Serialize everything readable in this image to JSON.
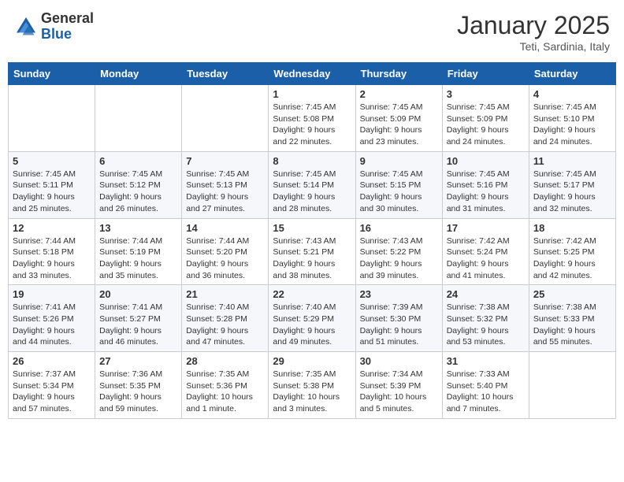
{
  "header": {
    "logo_general": "General",
    "logo_blue": "Blue",
    "month_title": "January 2025",
    "location": "Teti, Sardinia, Italy"
  },
  "days_of_week": [
    "Sunday",
    "Monday",
    "Tuesday",
    "Wednesday",
    "Thursday",
    "Friday",
    "Saturday"
  ],
  "weeks": [
    [
      {
        "day": "",
        "info": ""
      },
      {
        "day": "",
        "info": ""
      },
      {
        "day": "",
        "info": ""
      },
      {
        "day": "1",
        "info": "Sunrise: 7:45 AM\nSunset: 5:08 PM\nDaylight: 9 hours and 22 minutes."
      },
      {
        "day": "2",
        "info": "Sunrise: 7:45 AM\nSunset: 5:09 PM\nDaylight: 9 hours and 23 minutes."
      },
      {
        "day": "3",
        "info": "Sunrise: 7:45 AM\nSunset: 5:09 PM\nDaylight: 9 hours and 24 minutes."
      },
      {
        "day": "4",
        "info": "Sunrise: 7:45 AM\nSunset: 5:10 PM\nDaylight: 9 hours and 24 minutes."
      }
    ],
    [
      {
        "day": "5",
        "info": "Sunrise: 7:45 AM\nSunset: 5:11 PM\nDaylight: 9 hours and 25 minutes."
      },
      {
        "day": "6",
        "info": "Sunrise: 7:45 AM\nSunset: 5:12 PM\nDaylight: 9 hours and 26 minutes."
      },
      {
        "day": "7",
        "info": "Sunrise: 7:45 AM\nSunset: 5:13 PM\nDaylight: 9 hours and 27 minutes."
      },
      {
        "day": "8",
        "info": "Sunrise: 7:45 AM\nSunset: 5:14 PM\nDaylight: 9 hours and 28 minutes."
      },
      {
        "day": "9",
        "info": "Sunrise: 7:45 AM\nSunset: 5:15 PM\nDaylight: 9 hours and 30 minutes."
      },
      {
        "day": "10",
        "info": "Sunrise: 7:45 AM\nSunset: 5:16 PM\nDaylight: 9 hours and 31 minutes."
      },
      {
        "day": "11",
        "info": "Sunrise: 7:45 AM\nSunset: 5:17 PM\nDaylight: 9 hours and 32 minutes."
      }
    ],
    [
      {
        "day": "12",
        "info": "Sunrise: 7:44 AM\nSunset: 5:18 PM\nDaylight: 9 hours and 33 minutes."
      },
      {
        "day": "13",
        "info": "Sunrise: 7:44 AM\nSunset: 5:19 PM\nDaylight: 9 hours and 35 minutes."
      },
      {
        "day": "14",
        "info": "Sunrise: 7:44 AM\nSunset: 5:20 PM\nDaylight: 9 hours and 36 minutes."
      },
      {
        "day": "15",
        "info": "Sunrise: 7:43 AM\nSunset: 5:21 PM\nDaylight: 9 hours and 38 minutes."
      },
      {
        "day": "16",
        "info": "Sunrise: 7:43 AM\nSunset: 5:22 PM\nDaylight: 9 hours and 39 minutes."
      },
      {
        "day": "17",
        "info": "Sunrise: 7:42 AM\nSunset: 5:24 PM\nDaylight: 9 hours and 41 minutes."
      },
      {
        "day": "18",
        "info": "Sunrise: 7:42 AM\nSunset: 5:25 PM\nDaylight: 9 hours and 42 minutes."
      }
    ],
    [
      {
        "day": "19",
        "info": "Sunrise: 7:41 AM\nSunset: 5:26 PM\nDaylight: 9 hours and 44 minutes."
      },
      {
        "day": "20",
        "info": "Sunrise: 7:41 AM\nSunset: 5:27 PM\nDaylight: 9 hours and 46 minutes."
      },
      {
        "day": "21",
        "info": "Sunrise: 7:40 AM\nSunset: 5:28 PM\nDaylight: 9 hours and 47 minutes."
      },
      {
        "day": "22",
        "info": "Sunrise: 7:40 AM\nSunset: 5:29 PM\nDaylight: 9 hours and 49 minutes."
      },
      {
        "day": "23",
        "info": "Sunrise: 7:39 AM\nSunset: 5:30 PM\nDaylight: 9 hours and 51 minutes."
      },
      {
        "day": "24",
        "info": "Sunrise: 7:38 AM\nSunset: 5:32 PM\nDaylight: 9 hours and 53 minutes."
      },
      {
        "day": "25",
        "info": "Sunrise: 7:38 AM\nSunset: 5:33 PM\nDaylight: 9 hours and 55 minutes."
      }
    ],
    [
      {
        "day": "26",
        "info": "Sunrise: 7:37 AM\nSunset: 5:34 PM\nDaylight: 9 hours and 57 minutes."
      },
      {
        "day": "27",
        "info": "Sunrise: 7:36 AM\nSunset: 5:35 PM\nDaylight: 9 hours and 59 minutes."
      },
      {
        "day": "28",
        "info": "Sunrise: 7:35 AM\nSunset: 5:36 PM\nDaylight: 10 hours and 1 minute."
      },
      {
        "day": "29",
        "info": "Sunrise: 7:35 AM\nSunset: 5:38 PM\nDaylight: 10 hours and 3 minutes."
      },
      {
        "day": "30",
        "info": "Sunrise: 7:34 AM\nSunset: 5:39 PM\nDaylight: 10 hours and 5 minutes."
      },
      {
        "day": "31",
        "info": "Sunrise: 7:33 AM\nSunset: 5:40 PM\nDaylight: 10 hours and 7 minutes."
      },
      {
        "day": "",
        "info": ""
      }
    ]
  ]
}
